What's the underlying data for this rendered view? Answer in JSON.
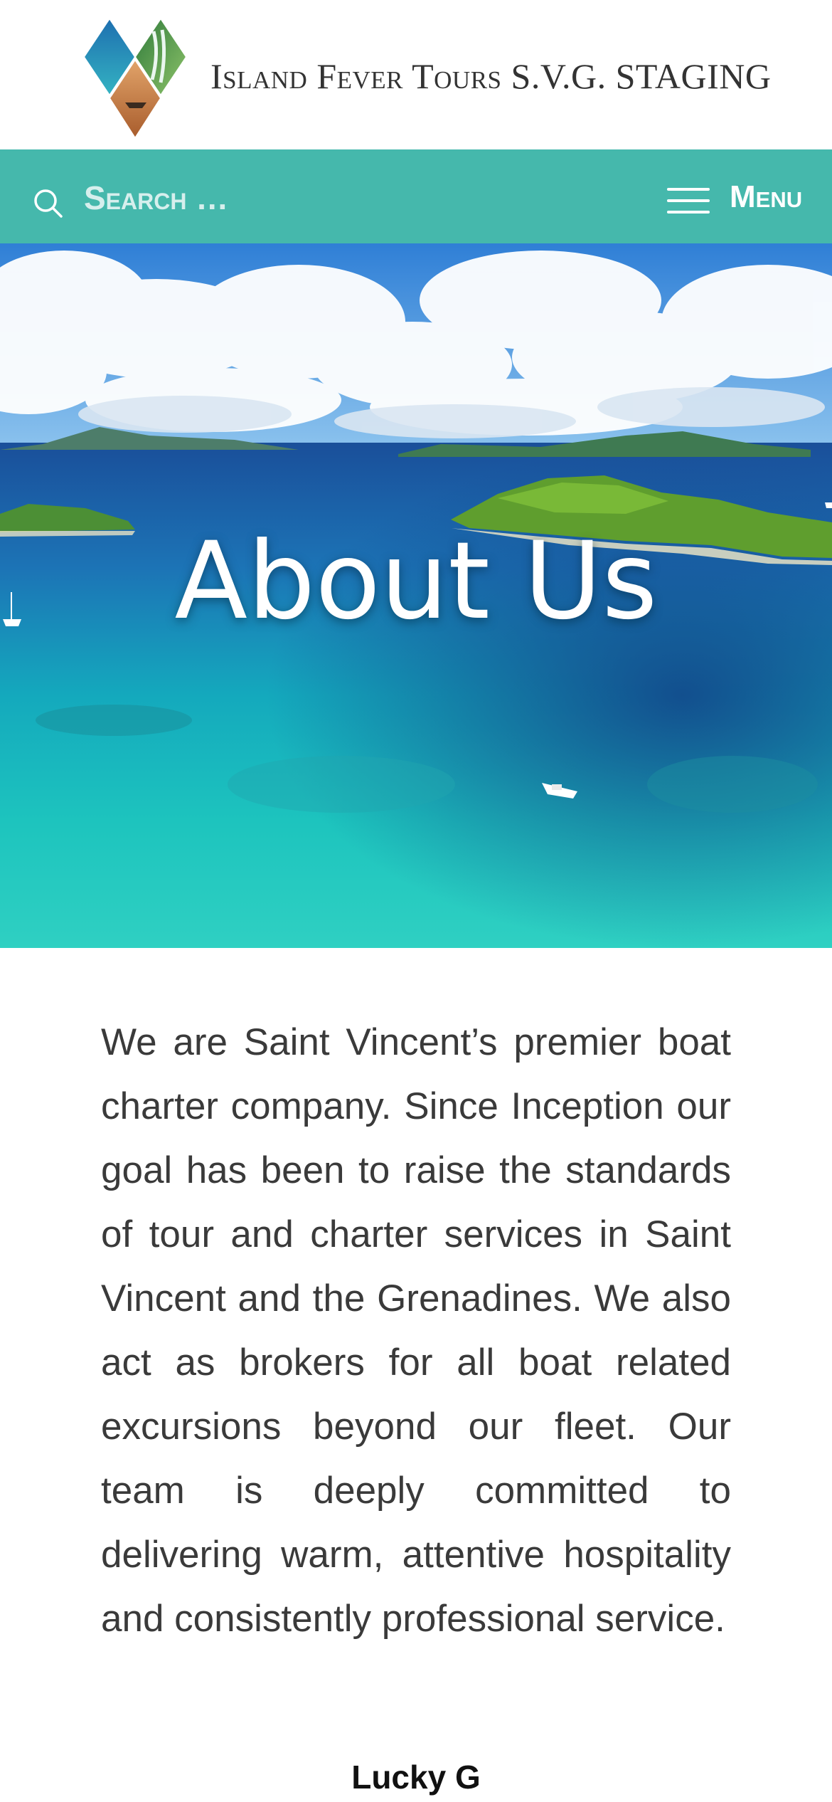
{
  "header": {
    "site_title": "Island Fever Tours S.V.G. STAGING",
    "logo_icon": "diamond-tiles-logo-icon"
  },
  "nav": {
    "search_placeholder": "Search …",
    "search_icon": "search-icon",
    "menu_label": "Menu",
    "menu_icon": "hamburger-icon"
  },
  "hero": {
    "title": "About Us"
  },
  "content": {
    "intro": "We are Saint Vincent’s premier boat charter company. Since Inception our goal has been to raise the standards of tour and charter services in Saint Vincent and the Grenadines.  We also act as brokers for all boat related excursions beyond our fleet. Our team is deeply committed to delivering warm, attentive hospitality and consistently professional service.",
    "heading": "Lucky G"
  },
  "colors": {
    "nav_background": "#45b8ac",
    "text": "#3a3a3a"
  }
}
